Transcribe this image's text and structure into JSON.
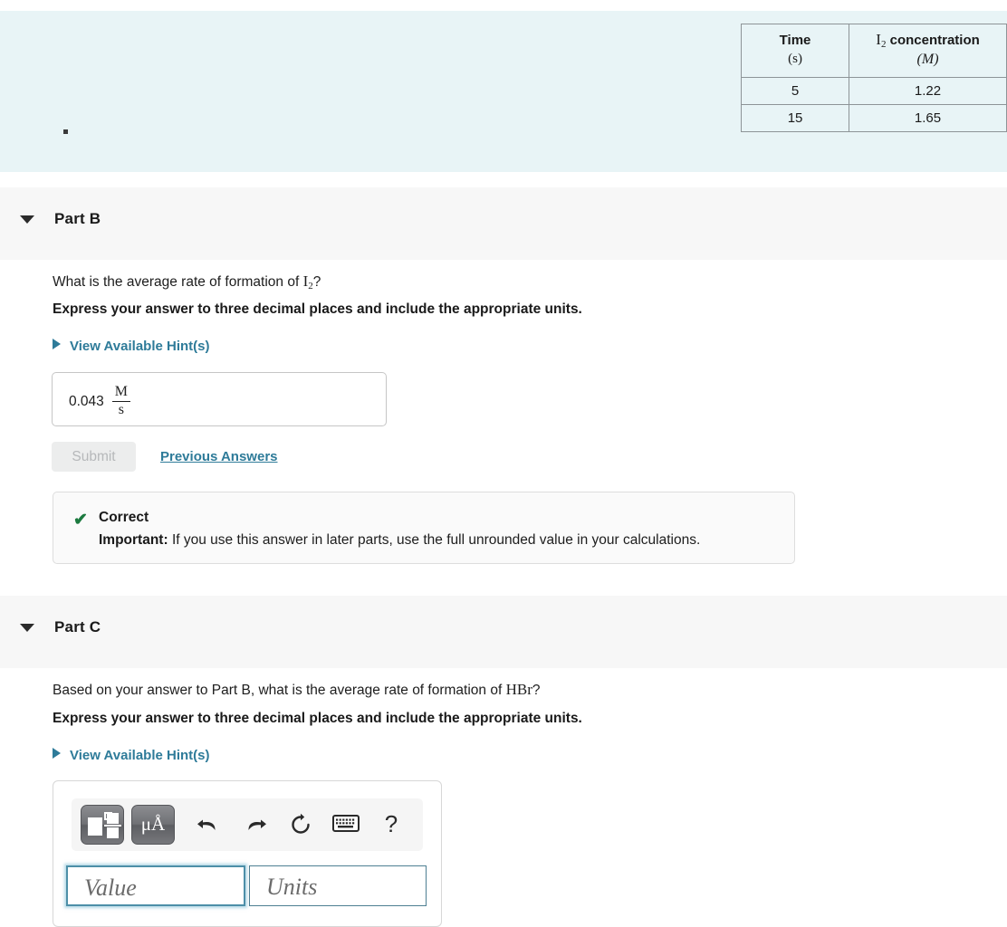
{
  "problem": {
    "table": {
      "headers": [
        {
          "line1": "Time",
          "line2": "(s)"
        },
        {
          "line1_prefix": "I",
          "line1_sub": "2",
          "line1_suffix": " concentration",
          "line2": "(M)"
        }
      ],
      "rows": [
        {
          "time": "5",
          "concentration": "1.22"
        },
        {
          "time": "15",
          "concentration": "1.65"
        }
      ]
    }
  },
  "parts": [
    {
      "id": "part-b",
      "title": "Part B",
      "question_prefix": "What is the average rate of formation of ",
      "question_symbol": "I",
      "question_sub": "2",
      "question_suffix": "?",
      "instruction": "Express your answer to three decimal places and include the appropriate units.",
      "hint_label": "View Available Hint(s)",
      "answer": {
        "value": "0.043",
        "unit_numerator": "M",
        "unit_denominator": "s"
      },
      "submit_label": "Submit",
      "previous_answers_label": "Previous Answers",
      "feedback": {
        "icon": "check-icon",
        "status": "Correct",
        "important_label": "Important:",
        "message": " If you use this answer in later parts, use the full unrounded value in your calculations."
      }
    },
    {
      "id": "part-c",
      "title": "Part C",
      "question_prefix": "Based on your answer to Part B, what is the average rate of formation of ",
      "question_symbol": "HBr",
      "question_sub": "",
      "question_suffix": "?",
      "instruction": "Express your answer to three decimal places and include the appropriate units.",
      "hint_label": "View Available Hint(s)",
      "answer_entry": {
        "toolbar": [
          {
            "name": "math-template-button",
            "label": ""
          },
          {
            "name": "units-button",
            "label": "μÅ"
          },
          {
            "name": "undo-icon",
            "label": ""
          },
          {
            "name": "redo-icon",
            "label": ""
          },
          {
            "name": "reset-icon",
            "label": ""
          },
          {
            "name": "keyboard-icon",
            "label": ""
          },
          {
            "name": "help-icon",
            "label": "?"
          }
        ],
        "value_placeholder": "Value",
        "units_placeholder": "Units"
      }
    }
  ],
  "colors": {
    "statement_background": "#e8f4f6",
    "part_header_background": "#f7f7f7",
    "link": "#2e7b99",
    "correct": "#1c7a3f",
    "focus_border": "#4d8fa8"
  }
}
